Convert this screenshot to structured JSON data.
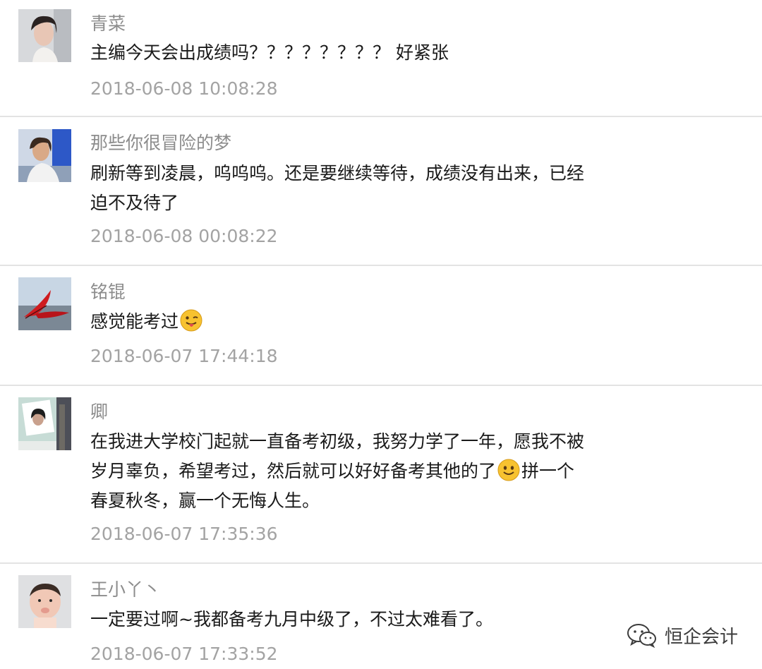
{
  "comments": [
    {
      "nickname": "青菜",
      "lines": [
        "主编今天会出成绩吗？？？？？？？？ 好紧张"
      ],
      "time": "2018-06-08 10:08:28"
    },
    {
      "nickname": "那些你很冒险的梦",
      "lines": [
        "刷新等到凌晨，呜呜呜。还是要继续等待，成绩没有出来，已经",
        "迫不及待了"
      ],
      "time": "2018-06-08 00:08:22"
    },
    {
      "nickname": "铭锟",
      "lines": [
        "感觉能考过"
      ],
      "emoji": "winking-tongue-emoji",
      "time": "2018-06-07 17:44:18"
    },
    {
      "nickname": "卿",
      "lines": [
        "在我进大学校门起就一直备考初级，我努力学了一年，愿我不被",
        "岁月辜负，希望考过，然后就可以好好备考其他的了",
        "春夏秋冬，赢一个无悔人生。"
      ],
      "line2_tail": "拼一个",
      "emoji": "smiling-emoji",
      "time": "2018-06-07 17:35:36"
    },
    {
      "nickname": "王小丫丶",
      "lines": [
        "一定要过啊~我都备考九月中级了，不过太难看了。"
      ],
      "time": "2018-06-07 17:33:52"
    }
  ],
  "watermark": {
    "text": "恒企会计",
    "icon": "wechat-icon"
  }
}
